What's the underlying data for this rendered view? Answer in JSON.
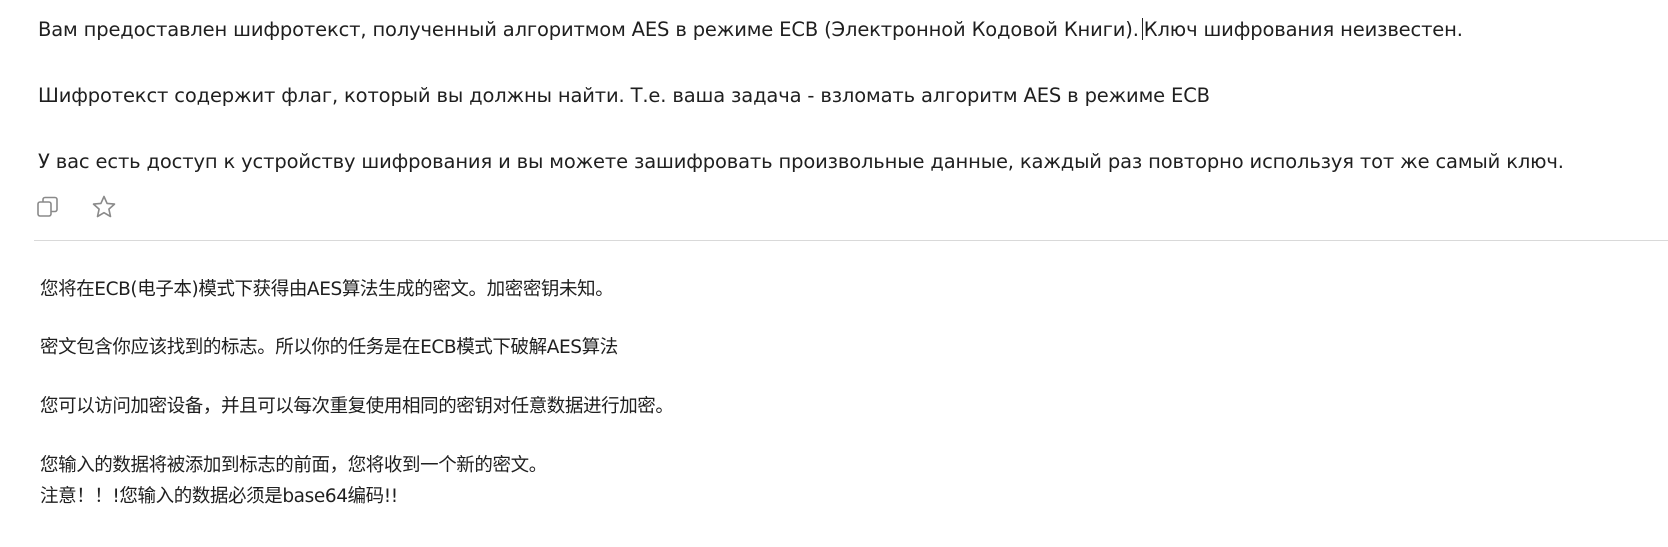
{
  "russian_message": {
    "paragraph1_part1": "Вам предоставлен шифротекст, полученный алгоритмом AES в режиме ECB (Электронной Кодовой Книги).",
    "paragraph1_part2": "Ключ шифрования неизвестен.",
    "paragraph2": "Шифротекст содержит флаг, который вы должны найти. Т.е. ваша задача - взломать алгоритм AES в режиме ECB",
    "paragraph3": "У вас есть доступ к устройству шифрования и вы можете зашифровать произвольные данные, каждый раз повторно используя тот же самый ключ."
  },
  "actions": {
    "copy_icon": "copy-icon",
    "star_icon": "star-icon"
  },
  "chinese_message": {
    "line1": "您将在ECB(电子本)模式下获得由AES算法生成的密文。加密密钥未知。",
    "line2": "密文包含你应该找到的标志。所以你的任务是在ECB模式下破解AES算法",
    "line3": "您可以访问加密设备，并且可以每次重复使用相同的密钥对任意数据进行加密。",
    "line4": "您输入的数据将被添加到标志的前面，您将收到一个新的密文。",
    "line5": "注意！！!您输入的数据必须是base64编码!!"
  }
}
